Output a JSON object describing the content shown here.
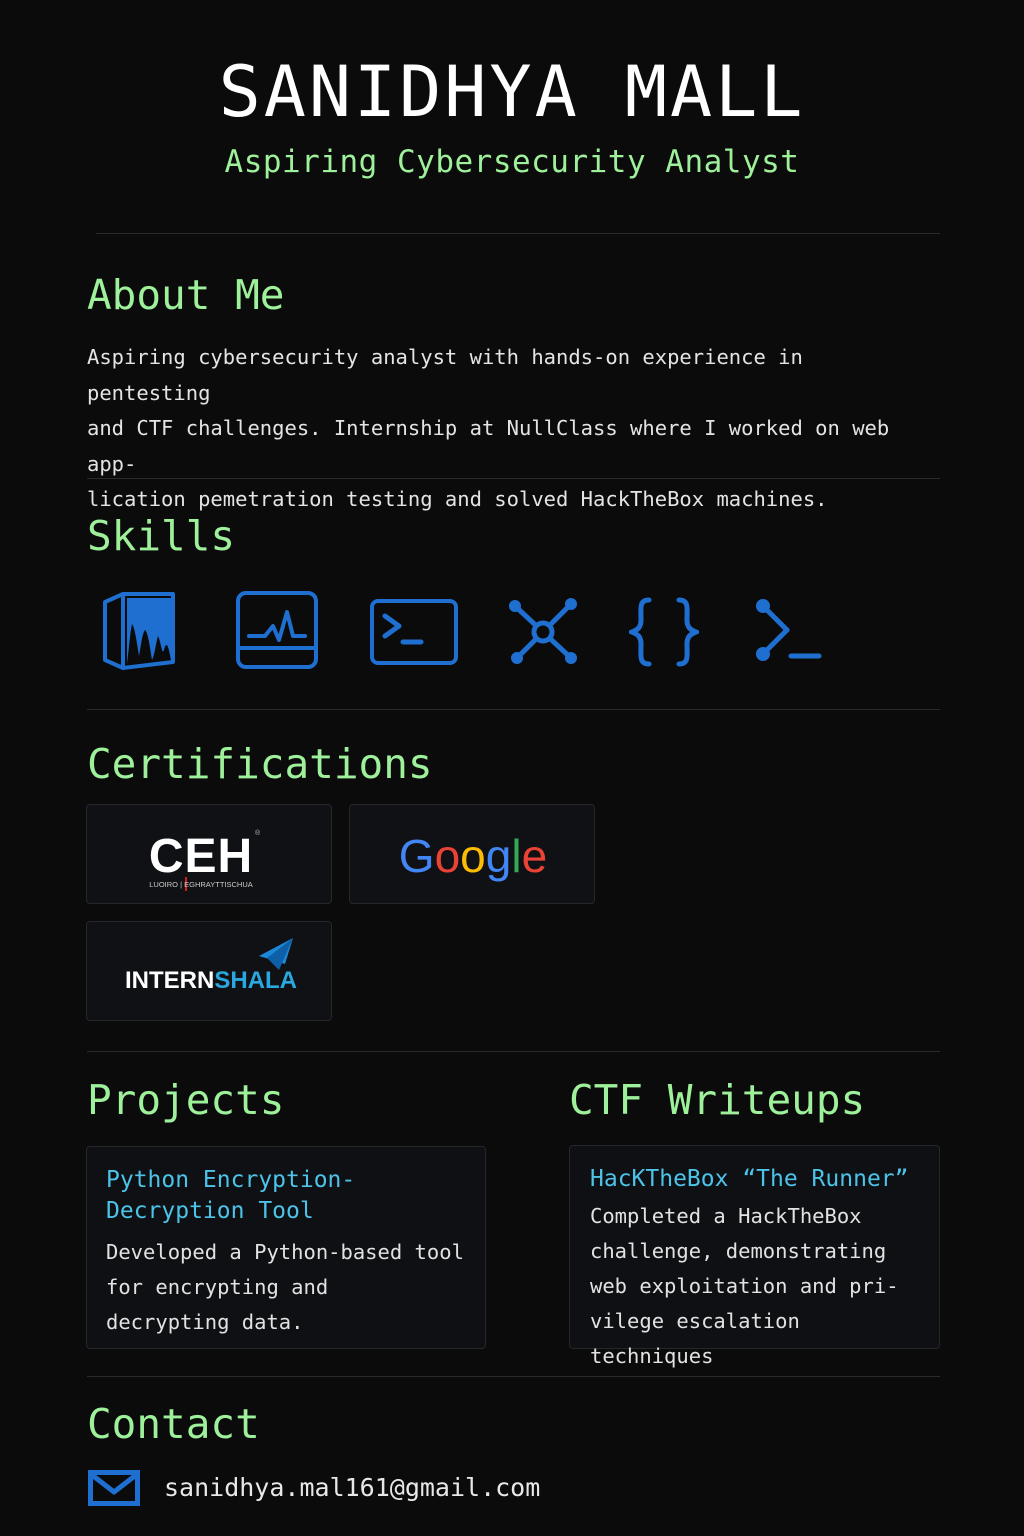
{
  "header": {
    "name": "SANIDHYA MALL",
    "tagline": "Aspiring Cybersecurity Analyst"
  },
  "about": {
    "title": "About Me",
    "lines": [
      "Aspiring cybersecurity analyst with hands-on experience in pentesting",
      "and CTF challenges. Internship at NullClass where I worked on web app-",
      "lication pemetration testing and solved HackTheBox machines."
    ]
  },
  "skills": {
    "title": "Skills",
    "icons": [
      "kali-linux-icon",
      "monitoring-icon",
      "terminal-window-icon",
      "network-icon",
      "code-braces-icon",
      "command-prompt-icon"
    ]
  },
  "certifications": {
    "title": "Certifications",
    "items": [
      {
        "name": "CEH",
        "subtitle": "LUOIRO | EGHRAYTTISCHUA",
        "mark": "®"
      },
      {
        "name": "Google"
      },
      {
        "name": "INTERN",
        "name_accent": "SHALA"
      }
    ]
  },
  "projects": {
    "title": "Projects",
    "items": [
      {
        "title_lines": [
          "Python Encryption-",
          "Decryption Tool"
        ],
        "desc_lines": [
          "Developed a Python-based tool",
          "for encrypting and",
          "decrypting data."
        ]
      }
    ]
  },
  "ctf": {
    "title": "CTF Writeups",
    "items": [
      {
        "title_lines": [
          "HacKTheBox “The Runner”"
        ],
        "desc_lines": [
          "Completed a HackTheBox",
          "challenge, demonstrating",
          "web exploitation and pri-",
          "vilege escalation techniques"
        ]
      }
    ]
  },
  "contact": {
    "title": "Contact",
    "email": "sanidhya.mal161@gmail.com",
    "icon": "envelope-icon"
  },
  "colors": {
    "background": "#0b0b0c",
    "heading_green": "#9ef09a",
    "icon_blue": "#1f6fd1",
    "card_title_cyan": "#4cc3e8"
  }
}
